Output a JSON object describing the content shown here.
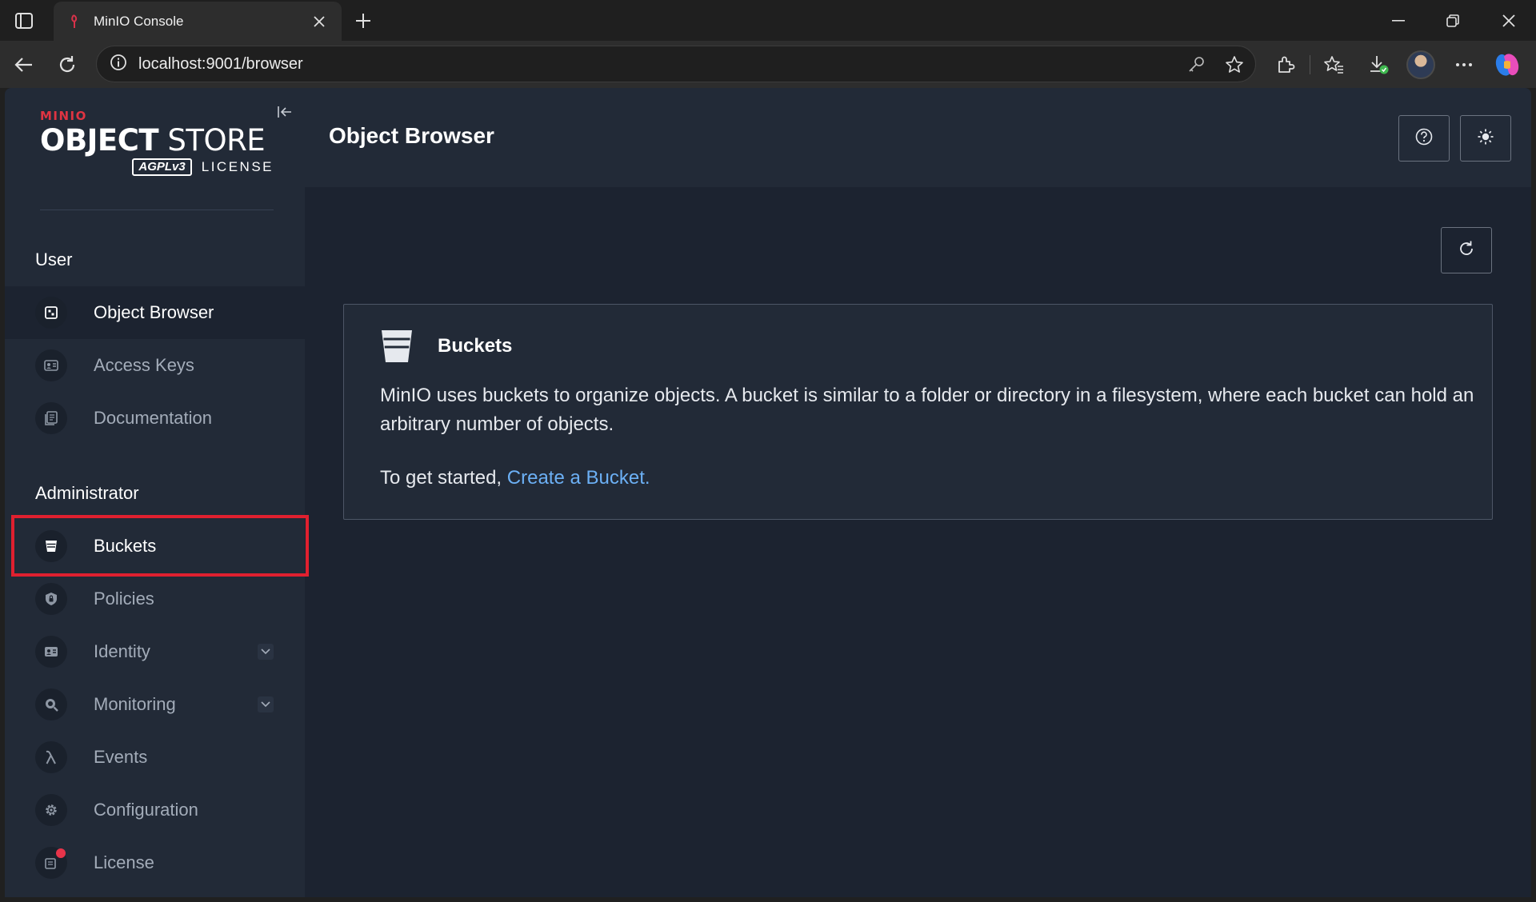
{
  "browser": {
    "tab_title": "MinIO Console",
    "url": "localhost:9001/browser"
  },
  "sidebar": {
    "logo": {
      "brand": "MINIO",
      "product_bold": "OBJECT",
      "product_light": " STORE",
      "agpl": "AGPLv3",
      "license_word": "LICENSE"
    },
    "user_section": "User",
    "user_items": [
      {
        "label": "Object Browser",
        "icon": "object-browser-icon",
        "active": true
      },
      {
        "label": "Access Keys",
        "icon": "access-keys-icon"
      },
      {
        "label": "Documentation",
        "icon": "documentation-icon"
      }
    ],
    "admin_section": "Administrator",
    "admin_items": [
      {
        "label": "Buckets",
        "icon": "bucket-icon",
        "highlighted": true
      },
      {
        "label": "Policies",
        "icon": "policy-shield-icon"
      },
      {
        "label": "Identity",
        "icon": "identity-card-icon",
        "expandable": true
      },
      {
        "label": "Monitoring",
        "icon": "monitoring-icon",
        "expandable": true
      },
      {
        "label": "Events",
        "icon": "lambda-icon"
      },
      {
        "label": "Configuration",
        "icon": "gear-icon"
      },
      {
        "label": "License",
        "icon": "license-icon",
        "notification": true
      }
    ]
  },
  "header": {
    "title": "Object Browser",
    "help_icon": "help-icon",
    "theme_icon": "sun-icon"
  },
  "main": {
    "refresh_icon": "refresh-icon",
    "card": {
      "title": "Buckets",
      "body": "MinIO uses buckets to organize objects. A bucket is similar to a folder or directory in a filesystem, where each bucket can hold an arbitrary number of objects.",
      "cta_prefix": "To get started, ",
      "cta_link": "Create a Bucket",
      "cta_suffix": "."
    }
  },
  "colors": {
    "accent_red": "#e0202f",
    "link_blue": "#6cb0f5",
    "sidebar_bg": "#222a37",
    "content_bg": "#1c2330"
  }
}
